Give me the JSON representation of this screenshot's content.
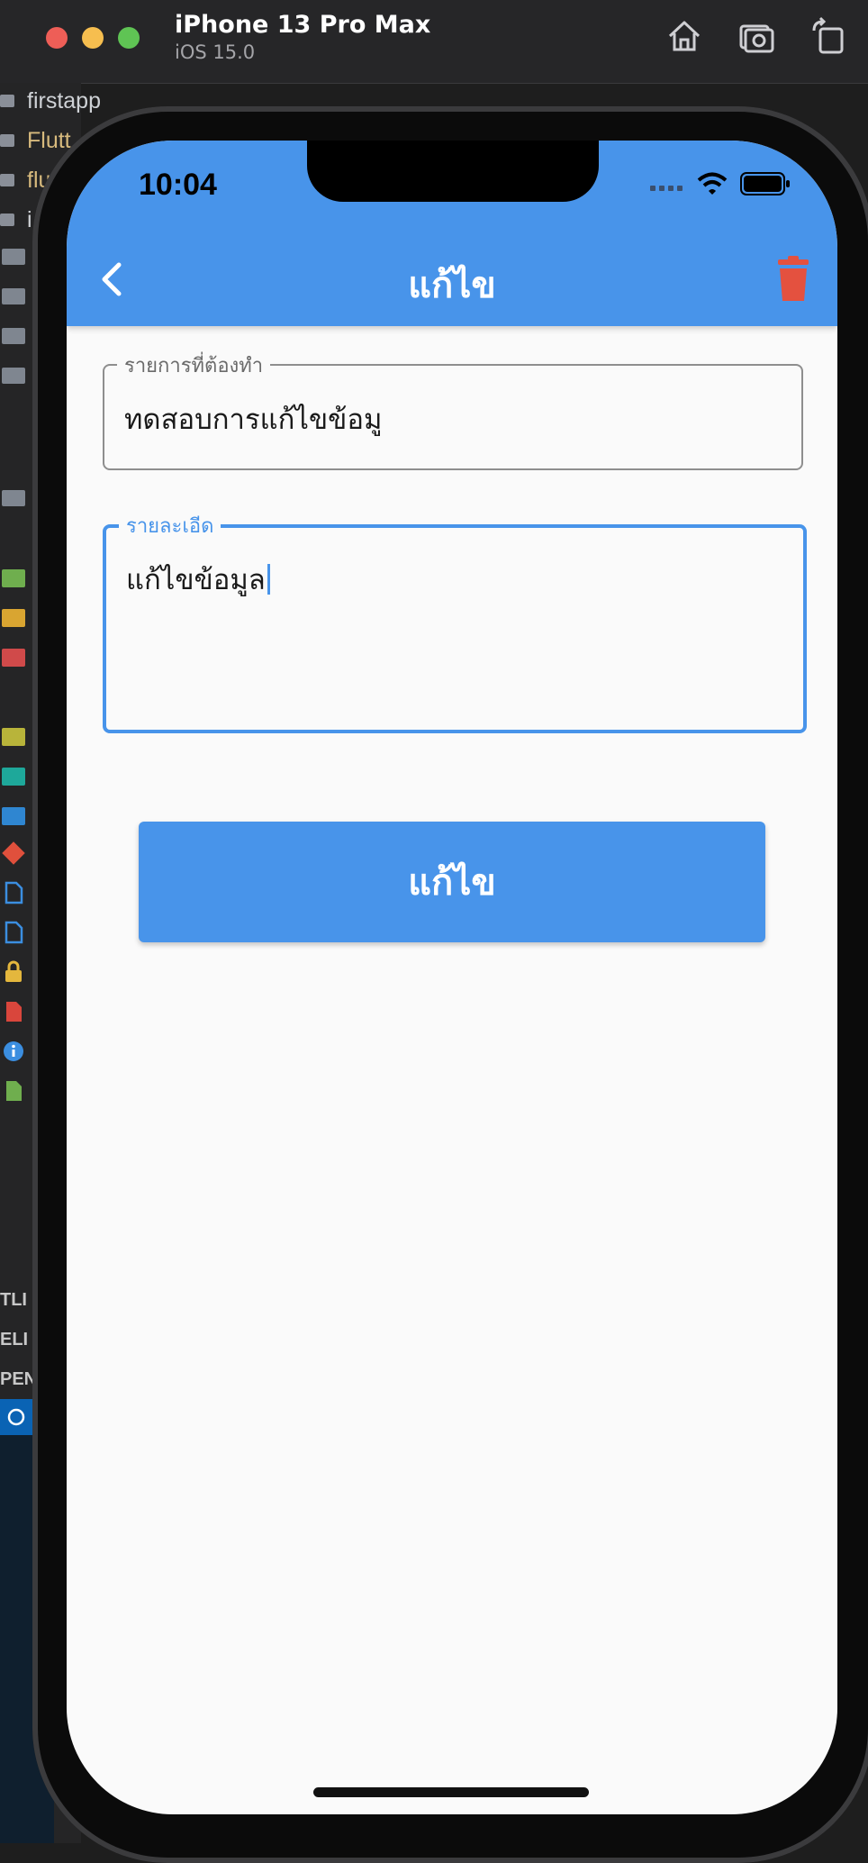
{
  "simulator": {
    "device_name": "iPhone 13 Pro Max",
    "os_version": "iOS 15.0",
    "toolbar_icons": [
      "home-icon",
      "screenshot-icon",
      "rotate-icon"
    ]
  },
  "editor_background": {
    "tree_items": [
      "firstapp",
      "Flutt",
      "flu",
      "i"
    ],
    "panel_labels": [
      "TLI",
      "ELI",
      "PEN"
    ]
  },
  "status_bar": {
    "time": "10:04"
  },
  "appbar": {
    "title": "แก้ไข",
    "back_icon": "chevron-left-icon",
    "delete_icon": "trash-icon",
    "delete_color": "#e4513f",
    "background_color": "#4894ea"
  },
  "form": {
    "title_field": {
      "label": "รายการที่ต้องทำ",
      "value": "ทดสอบการแก้ไขข้อมู"
    },
    "detail_field": {
      "label": "รายละเอีด",
      "value": "แก้ไขข้อมูล",
      "focused": true
    },
    "submit_label": "แก้ไข"
  }
}
